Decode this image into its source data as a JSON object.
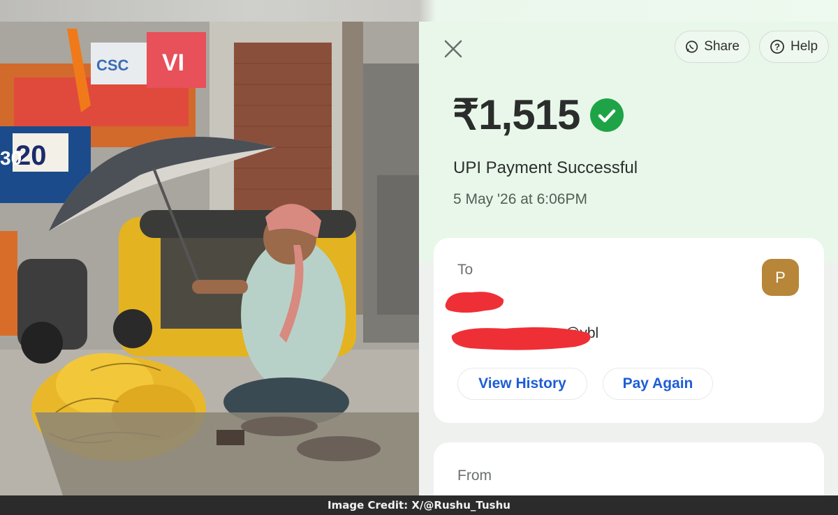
{
  "header": {
    "share_label": "Share",
    "help_label": "Help"
  },
  "payment": {
    "amount": "₹1,515",
    "status": "UPI Payment Successful",
    "timestamp": "5 May '26 at 6:06PM"
  },
  "to_card": {
    "label": "To",
    "avatar_initial": "P",
    "upi_visible_suffix": "@ybl",
    "view_history_label": "View History",
    "pay_again_label": "Pay Again"
  },
  "from_card": {
    "label": "From"
  },
  "photo": {
    "shop_sign_text": "VI",
    "shop_sign_2": "CSC",
    "price_board_1": "20",
    "price_board_2": "30"
  },
  "credit": {
    "text": "Image Credit: X/@Rushu_Tushu"
  },
  "colors": {
    "success_green": "#1ea446",
    "link_blue": "#1d5dd6",
    "avatar_bg": "#b78638",
    "redaction_red": "#ef2f36"
  },
  "icons": [
    "close-icon",
    "whatsapp-icon",
    "help-icon",
    "success-check-icon"
  ]
}
